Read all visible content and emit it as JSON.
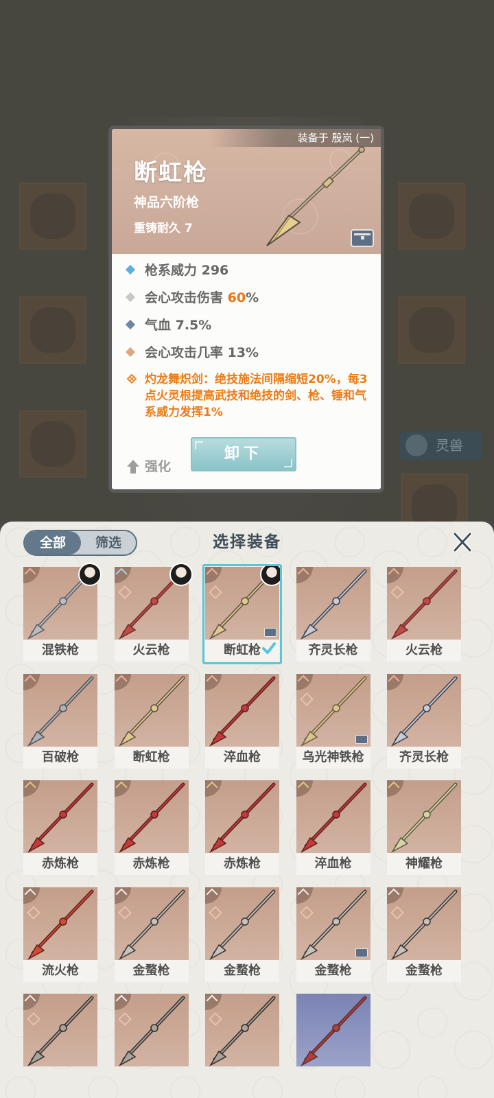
{
  "background": {
    "pet_button_label": "灵兽"
  },
  "detail": {
    "equipped_to": "装备于 殷岚 (一)",
    "name": "断虹枪",
    "grade": "神品六阶枪",
    "durability": "重铸耐久 7",
    "stats": [
      {
        "icon": "diamond-blue-icon",
        "label": "枪系威力 296",
        "pre": "",
        "highlight": "",
        "post": ""
      },
      {
        "icon": "diamond-grey-icon",
        "label": "",
        "pre": "会心攻击伤害 ",
        "highlight": "60",
        "post": "%"
      },
      {
        "icon": "diamond-slate-icon",
        "label": "气血 7.5%",
        "pre": "",
        "highlight": "",
        "post": ""
      },
      {
        "icon": "diamond-tan-icon",
        "label": "会心攻击几率 13%",
        "pre": "",
        "highlight": "",
        "post": ""
      }
    ],
    "skill_text": "灼龙舞炽剑：绝技施法间隔缩短20%，每3点火灵根提高武技和绝技的剑、枪、锤和气系威力发挥1%",
    "upgrade_label": "强化",
    "unequip_label": "卸下",
    "colors": {
      "accent_orange": "#ec7c15",
      "button_teal": "#88c3c8"
    }
  },
  "sheet": {
    "filter_all": "全部",
    "filter_filter": "筛选",
    "title": "选择装备",
    "items": [
      {
        "name": "混铁枪",
        "tier": "red",
        "skill": false,
        "owner": true,
        "chest": false,
        "selected": false,
        "art": "purple-false"
      },
      {
        "name": "火云枪",
        "tier": "blue",
        "skill": true,
        "owner": true,
        "chest": false,
        "selected": false
      },
      {
        "name": "断虹枪",
        "tier": "red",
        "skill": true,
        "owner": true,
        "chest": true,
        "selected": true
      },
      {
        "name": "齐灵长枪",
        "tier": "red",
        "skill": false,
        "owner": false,
        "chest": false,
        "selected": false
      },
      {
        "name": "火云枪",
        "tier": "red",
        "skill": true,
        "owner": false,
        "chest": false,
        "selected": false
      },
      {
        "name": "百破枪",
        "tier": "red",
        "skill": false,
        "owner": false,
        "chest": false,
        "selected": false
      },
      {
        "name": "断虹枪",
        "tier": "red",
        "skill": false,
        "owner": false,
        "chest": false,
        "selected": false
      },
      {
        "name": "淬血枪",
        "tier": "red",
        "skill": false,
        "owner": false,
        "chest": false,
        "selected": false
      },
      {
        "name": "乌光神铁枪",
        "tier": "red",
        "skill": true,
        "owner": false,
        "chest": true,
        "selected": false
      },
      {
        "name": "齐灵长枪",
        "tier": "red",
        "skill": false,
        "owner": false,
        "chest": false,
        "selected": false
      },
      {
        "name": "赤炼枪",
        "tier": "gold",
        "skill": false,
        "owner": false,
        "chest": false,
        "selected": false
      },
      {
        "name": "赤炼枪",
        "tier": "gold",
        "skill": false,
        "owner": false,
        "chest": false,
        "selected": false
      },
      {
        "name": "赤炼枪",
        "tier": "gold",
        "skill": false,
        "owner": false,
        "chest": false,
        "selected": false
      },
      {
        "name": "淬血枪",
        "tier": "gold",
        "skill": false,
        "owner": false,
        "chest": false,
        "selected": false
      },
      {
        "name": "神耀枪",
        "tier": "gold",
        "skill": false,
        "owner": false,
        "chest": false,
        "selected": false
      },
      {
        "name": "流火枪",
        "tier": "white",
        "skill": true,
        "owner": false,
        "chest": false,
        "selected": false
      },
      {
        "name": "金蝥枪",
        "tier": "white",
        "skill": true,
        "owner": false,
        "chest": false,
        "selected": false
      },
      {
        "name": "金蝥枪",
        "tier": "white",
        "skill": true,
        "owner": false,
        "chest": false,
        "selected": false
      },
      {
        "name": "金蝥枪",
        "tier": "white",
        "skill": true,
        "owner": false,
        "chest": true,
        "selected": false
      },
      {
        "name": "金蝥枪",
        "tier": "white",
        "skill": true,
        "owner": false,
        "chest": false,
        "selected": false
      },
      {
        "name": "",
        "tier": "white",
        "skill": true,
        "owner": false,
        "chest": false,
        "selected": false
      },
      {
        "name": "",
        "tier": "white",
        "skill": true,
        "owner": false,
        "chest": false,
        "selected": false
      },
      {
        "name": "",
        "tier": "white",
        "skill": true,
        "owner": false,
        "chest": false,
        "selected": false
      },
      {
        "name": "",
        "tier": "none",
        "skill": false,
        "owner": false,
        "chest": false,
        "selected": false,
        "purple": true
      }
    ]
  }
}
